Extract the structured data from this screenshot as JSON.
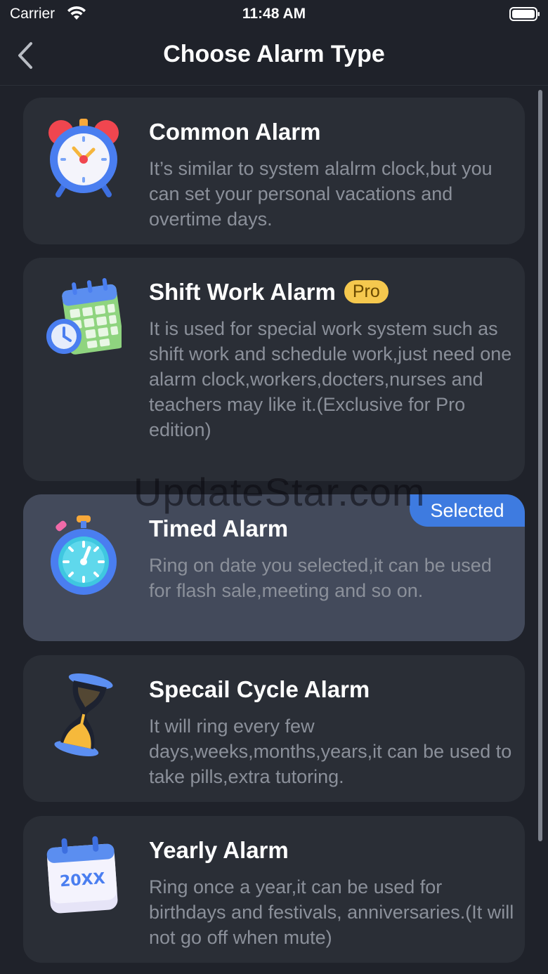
{
  "status": {
    "carrier": "Carrier",
    "time": "11:48 AM"
  },
  "nav": {
    "title": "Choose Alarm Type"
  },
  "alarm_types": [
    {
      "title": "Common Alarm",
      "description": "It’s similar to system alalrm clock,but you can set your personal vacations and overtime days.",
      "icon": "alarm-clock-icon"
    },
    {
      "title": "Shift Work Alarm",
      "badge": "Pro",
      "description": "It is used for special work system such as shift work and schedule work,just need one alarm clock,workers,docters,nurses and teachers may like it.(Exclusive for Pro edition)",
      "icon": "calendar-clock-icon"
    },
    {
      "title": "Timed Alarm",
      "selected_label": "Selected",
      "description": "Ring on date you selected,it can be used for flash sale,meeting and so on.",
      "icon": "stopwatch-icon"
    },
    {
      "title": "Specail Cycle Alarm",
      "description": "It will ring every few days,weeks,months,years,it can be used to take pills,extra tutoring.",
      "icon": "hourglass-icon"
    },
    {
      "title": "Yearly Alarm",
      "description": "Ring once a year,it can be used for birthdays and festivals, anniversaries.(It will not go off when mute)",
      "icon": "yearly-calendar-icon",
      "icon_text": "20XX"
    }
  ],
  "watermark": "UpdateStar.com",
  "colors": {
    "background": "#1f222a",
    "card": "#2a2e36",
    "card_selected": "#434a5b",
    "accent": "#3e7be0",
    "pro": "#f5c84e"
  }
}
